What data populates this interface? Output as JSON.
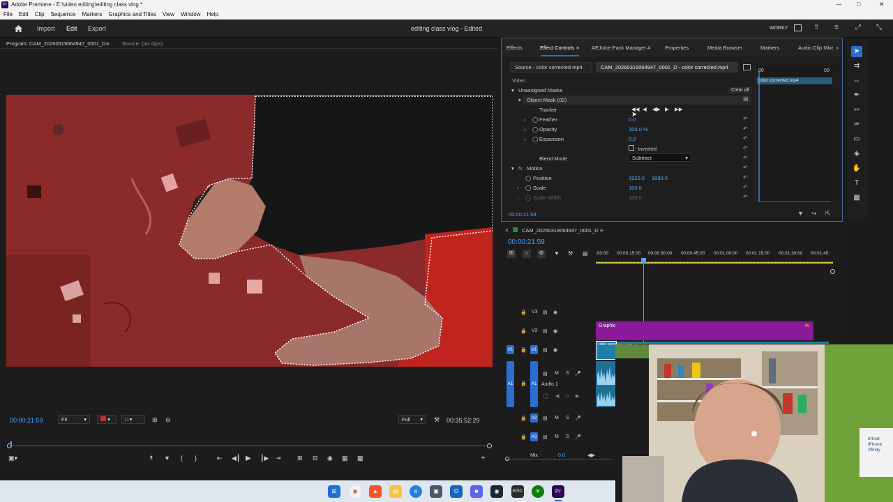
{
  "window": {
    "title": "Adobe Premiere - E:\\video editing\\editing class vlog *",
    "icon_label": "Pr"
  },
  "menu": [
    "File",
    "Edit",
    "Clip",
    "Sequence",
    "Markers",
    "Graphics and Titles",
    "View",
    "Window",
    "Help"
  ],
  "header": {
    "nav": [
      "Import",
      "Edit",
      "Export"
    ],
    "document": "editing class vlog",
    "document_status": "- Edited",
    "workspace": "WORKY"
  },
  "program": {
    "tab_program": "Program: CAM_20260319064947_0001_D",
    "tab_source": "Source: (no clips)",
    "timecode": "00:00:21:59",
    "fit": "Fit",
    "quality": "Full",
    "duration": "00:35:52:29"
  },
  "effects_tabs": [
    "Effects",
    "Effect Controls",
    "AEJuice Pack Manager 4",
    "Properties",
    "Media Browser",
    "Markers",
    "Audio Clip Mixer"
  ],
  "effect_controls": {
    "source_tab": "Source - color corrected.mp4",
    "clip_tab": "CAM_20260319064947_0001_D - color corrected.mp4",
    "mini_clip": "color corrected.mp4",
    "mini_time_left": "00",
    "mini_time_right": "00",
    "section_video": "Video",
    "unassigned_masks": "Unassigned Masks",
    "clear_all": "Clear all",
    "object_mask": "Object Mask (02)",
    "tracker": "Tracker",
    "feather": "Feather",
    "feather_val": "0.0",
    "opacity": "Opacity",
    "opacity_val": "100.0 %",
    "expansion": "Expansion",
    "expansion_val": "0.0",
    "inverted": "Inverted",
    "blend_mode": "Blend Mode",
    "blend_mode_val": "Subtract",
    "motion": "Motion",
    "fx_badge": "fx",
    "position": "Position",
    "position_x": "1920.0",
    "position_y": "1080.0",
    "scale": "Scale",
    "scale_val": "100.0",
    "scale_width": "Scale Width",
    "scale_width_val": "100.0",
    "timecode": "00:00:21:59"
  },
  "timeline": {
    "sequence": "CAM_20260319064947_0001_D",
    "timecode": "00:00:21:59",
    "ruler": [
      ":00:00",
      "00:00:15:00",
      "00:00:30:00",
      "00:00:45:00",
      "00:01:00:00",
      "00:01:15:00",
      "00:01:30:00",
      "00:01:45:"
    ],
    "tracks": {
      "v3": "V3",
      "v2": "V2",
      "v1": "V1",
      "a1": "A1",
      "a2": "A2",
      "a3": "A3",
      "audio1": "Audio 1",
      "mix": "Mix",
      "mix_val": "0.0"
    },
    "clip_graphic": "Graphic",
    "clip_graphic_fx": "fx",
    "clip_video": "color corrected.mp4 [V]"
  },
  "taskbar_apps": [
    "start",
    "chrome",
    "brave",
    "explorer",
    "edge",
    "store",
    "outlook",
    "discord",
    "steam",
    "epic",
    "xbox",
    "premiere"
  ],
  "webcam": {
    "sign_text": "Introd\niPhone\nXfinity"
  },
  "colors": {
    "accent": "#2b6ed1",
    "timecode": "#4aa3ff",
    "graphic_clip": "#8a1a9a",
    "video_clip": "#1f7fa8",
    "mask_tint": "#8e2c2c"
  }
}
